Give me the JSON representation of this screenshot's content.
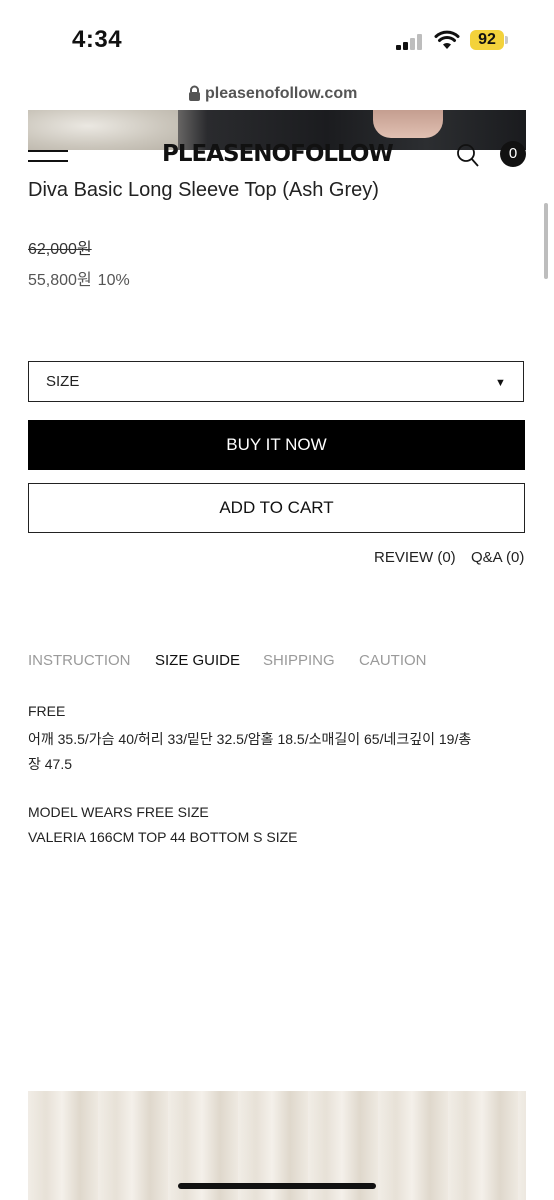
{
  "status_bar": {
    "time": "4:34",
    "battery": "92"
  },
  "browser": {
    "url": "pleasenofollow.com"
  },
  "header": {
    "brand": "PLEASENOFOLLOW",
    "cart_count": "0"
  },
  "product": {
    "title": "Diva Basic Long Sleeve Top (Ash Grey)",
    "original_price": "62,000원",
    "sale_price": "55,800원",
    "discount": "10%"
  },
  "options": {
    "size_label": "SIZE",
    "caret": "▼"
  },
  "actions": {
    "buy_now": "BUY IT NOW",
    "add_to_cart": "ADD TO CART",
    "review": "REVIEW (0)",
    "qa": "Q&A (0)"
  },
  "tabs": [
    {
      "label": "INSTRUCTION",
      "active": false
    },
    {
      "label": "SIZE GUIDE",
      "active": true
    },
    {
      "label": "SHIPPING",
      "active": false
    },
    {
      "label": "CAUTION",
      "active": false
    }
  ],
  "size_guide": {
    "size": "FREE",
    "measurements_line1": "어깨 35.5/가슴 40/허리 33/밑단 32.5/암홀 18.5/소매길이 65/네크깊이 19/총",
    "measurements_line2": "장 47.5",
    "model_line1": "MODEL WEARS FREE SIZE",
    "model_line2": "VALERIA 166CM TOP 44 BOTTOM S SIZE"
  },
  "colors": {
    "primary": "#000000",
    "muted_tab": "#9a9a9a",
    "battery": "#f3d23b"
  }
}
